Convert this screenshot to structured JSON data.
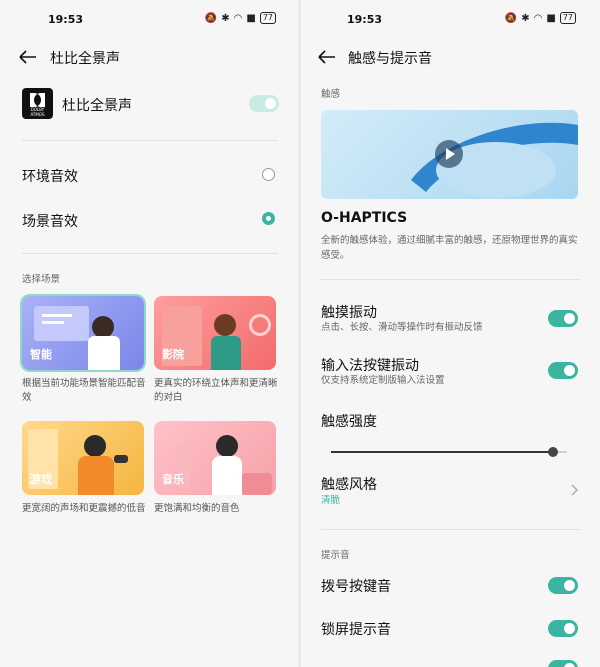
{
  "left": {
    "status": {
      "time": "19:53",
      "battery": "77"
    },
    "title": "杜比全景声",
    "dolby": {
      "label": "杜比全景声",
      "logo_text": "DOLBY",
      "logo_sub": "ATMOS"
    },
    "options": [
      {
        "label": "环境音效",
        "selected": false
      },
      {
        "label": "场景音效",
        "selected": true
      }
    ],
    "section_label": "选择场景",
    "scenes": [
      {
        "label": "智能",
        "desc": "根据当前功能场景智能匹配音效"
      },
      {
        "label": "影院",
        "desc": "更真实的环绕立体声和更清晰的对白"
      },
      {
        "label": "游戏",
        "desc": "更宽阔的声场和更震撼的低音"
      },
      {
        "label": "音乐",
        "desc": "更饱满和均衡的音色"
      }
    ]
  },
  "right": {
    "status": {
      "time": "19:53",
      "battery": "77"
    },
    "title": "触感与提示音",
    "haptics_section": "触感",
    "ohaptics": {
      "title": "O-HAPTICS",
      "desc": "全新的触感体验，通过细腻丰富的触感，还原物理世界的真实感受。"
    },
    "touch_vibration": {
      "label": "触摸振动",
      "desc": "点击、长按、滑动等操作时有振动反馈",
      "on": true
    },
    "ime_vibration": {
      "label": "输入法按键振动",
      "desc": "仅支持系统定制版输入法设置",
      "on": true
    },
    "intensity": {
      "label": "触感强度",
      "value": 0.94
    },
    "style": {
      "label": "触感风格",
      "value": "清脆"
    },
    "sound_section": "提示音",
    "dial_sound": {
      "label": "拨号按键音",
      "on": true
    },
    "lock_sound": {
      "label": "锁屏提示音",
      "on": true
    }
  },
  "colors": {
    "accent": "#3bb5a1"
  }
}
